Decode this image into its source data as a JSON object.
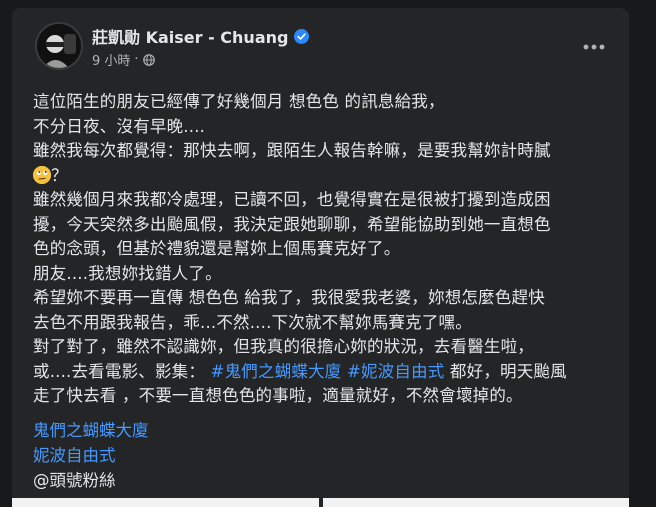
{
  "post": {
    "author": "莊凱勛 Kaiser - Chuang",
    "time": "9 小時",
    "dot": "·",
    "lines_a": [
      "這位陌生的朋友已經傳了好幾個月 想色色 的訊息給我，",
      "不分日夜、沒有早晚....",
      "雖然我每次都覺得：那快去啊，跟陌生人報告幹嘛，是要我幫妳計時膩"
    ],
    "line_emoji_suffix": "？",
    "lines_b": [
      "雖然幾個月來我都冷處理，已讀不回，也覺得實在是很被打擾到造成困",
      "擾，今天突然多出颱風假，我決定跟她聊聊，希望能協助到她一直想色",
      "色的念頭，但基於禮貌還是幫妳上個馬賽克好了。",
      "朋友....我想妳找錯人了。",
      "希望妳不要再一直傳 想色色 給我了，我很愛我老婆，妳想怎麼色趕快",
      "去色不用跟我報告，乖...不然....下次就不幫妳馬賽克了嘿。",
      "對了對了，雖然不認識妳，但我真的很擔心妳的狀況，去看醫生啦，"
    ],
    "line_hash_prefix": "或....去看電影、影集：",
    "hashtag1": "#鬼們之蝴蝶大廈",
    "hashtag2": "#妮波自由式",
    "line_hash_suffix": "都好，明天颱風",
    "line_last": "走了快去看 ，不要一直想色色的事啦，適量就好，不然會壞掉的。",
    "tag_links": [
      "鬼們之蝴蝶大廈",
      "妮波自由式"
    ],
    "mention": "@頭號粉絲"
  },
  "icons": {
    "verified": "verified-badge-icon",
    "privacy": "globe-icon",
    "more": "more-options-icon",
    "emoji": "eye-roll-emoji-icon"
  },
  "colors": {
    "background": "#18191a",
    "card": "#242526",
    "text": "#e4e6eb",
    "secondary": "#b0b3b8",
    "link": "#4599ff",
    "verified": "#2d88ff"
  }
}
